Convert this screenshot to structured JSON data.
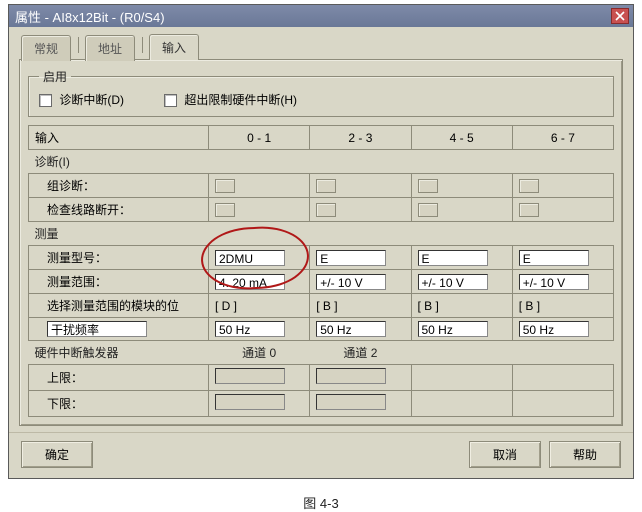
{
  "window": {
    "title": "属性 - AI8x12Bit - (R0/S4)"
  },
  "tabs": {
    "general": "常规",
    "address": "地址",
    "input": "输入"
  },
  "enable": {
    "legend": "启用",
    "diag_interrupt": "诊断中断(D)",
    "hw_limit_interrupt": "超出限制硬件中断(H)"
  },
  "columns": {
    "label": "输入",
    "c0": "0 - 1",
    "c1": "2 - 3",
    "c2": "4 - 5",
    "c3": "6 - 7"
  },
  "diag": {
    "legend": "诊断(I)",
    "group": "组诊断：",
    "wirebreak": "检查线路断开："
  },
  "meas": {
    "legend": "测量",
    "type_label": "测量型号：",
    "range_label": "测量范围：",
    "type": {
      "c0": "2DMU",
      "c1": "E",
      "c2": "E",
      "c3": "E"
    },
    "range": {
      "c0": "4..20 mA",
      "c1": "+/- 10 V",
      "c2": "+/- 10 V",
      "c3": "+/- 10 V"
    },
    "modpos_label": "选择测量范围的模块的位",
    "modpos": {
      "c0": "[ D ]",
      "c1": "[ B ]",
      "c2": "[ B ]",
      "c3": "[ B ]"
    },
    "noise_label": "干扰频率",
    "noise": {
      "c0": "50 Hz",
      "c1": "50 Hz",
      "c2": "50 Hz",
      "c3": "50 Hz"
    }
  },
  "hwtrig": {
    "legend": "硬件中断触发器",
    "ch0": "通道 0",
    "ch2": "通道 2",
    "upper": "上限：",
    "lower": "下限："
  },
  "buttons": {
    "ok": "确定",
    "cancel": "取消",
    "help": "帮助"
  },
  "caption": "图 4-3"
}
